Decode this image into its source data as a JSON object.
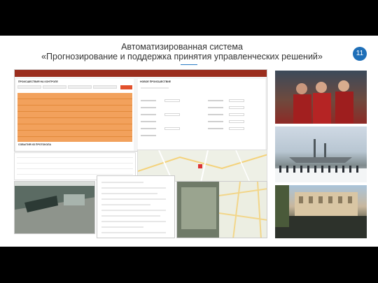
{
  "slide": {
    "title_line1": "Автоматизированная система",
    "title_line2": "«Прогнозирование и поддержка принятия управленческих решений»",
    "page_number": "11"
  },
  "app": {
    "left_panel_title": "ПРОИСШЕСТВИЯ НА КОНТРОЛЕ",
    "right_panel_title": "НОВОЕ ПРОИСШЕСТВИЕ",
    "events_title": "СОБЫТИЯ ИЗ ПРОТОКОЛА",
    "accent_red": "#9a2d1d",
    "accent_orange": "#f2a15c"
  },
  "colors": {
    "badge": "#1f6fb8",
    "frame": "#000000"
  }
}
